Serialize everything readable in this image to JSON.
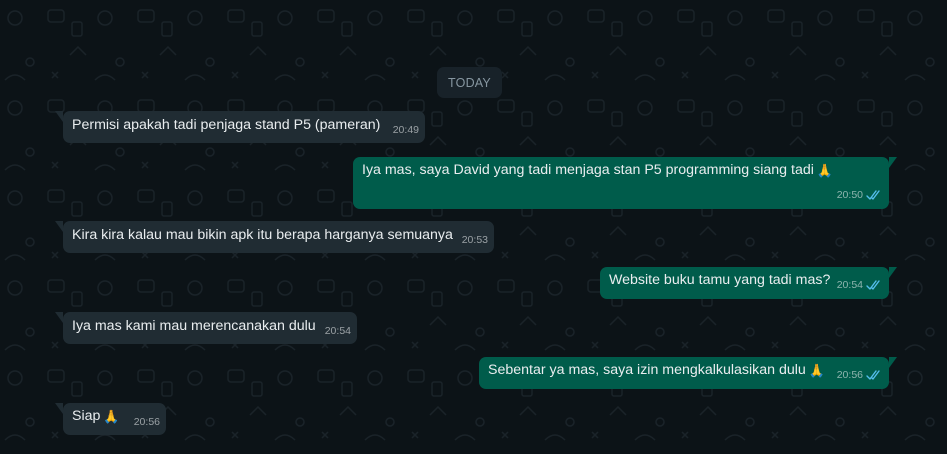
{
  "date_divider": "TODAY",
  "messages": [
    {
      "direction": "in",
      "text": "Permisi apakah tadi penjaga  stand P5 (pameran)",
      "time": "20:49"
    },
    {
      "direction": "out",
      "text": "Iya mas, saya David yang tadi menjaga stan P5 programming siang tadi",
      "emoji": "🙏",
      "time": "20:50",
      "status": "read"
    },
    {
      "direction": "in",
      "text": "Kira kira kalau mau bikin apk itu berapa harganya semuanya",
      "time": "20:53"
    },
    {
      "direction": "out",
      "text": "Website buku tamu yang tadi mas?",
      "time": "20:54",
      "status": "read"
    },
    {
      "direction": "in",
      "text": "Iya mas kami mau merencanakan dulu",
      "time": "20:54"
    },
    {
      "direction": "out",
      "text": "Sebentar ya mas, saya izin mengkalkulasikan dulu",
      "emoji": "🙏",
      "time": "20:56",
      "status": "read"
    },
    {
      "direction": "in",
      "text": "Siap",
      "emoji": "🙏",
      "time": "20:56"
    }
  ],
  "colors": {
    "background": "#0b141a",
    "incoming_bubble": "#202c33",
    "outgoing_bubble": "#005c4b",
    "read_tick": "#53bdeb"
  }
}
